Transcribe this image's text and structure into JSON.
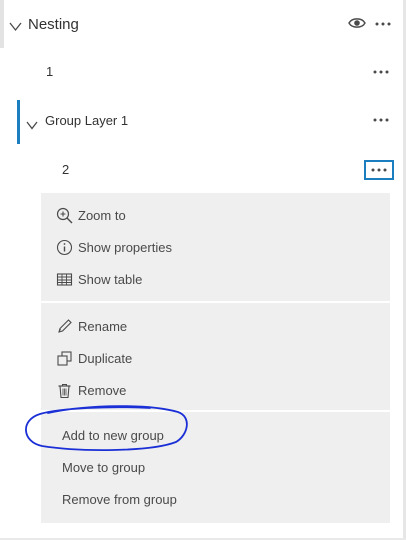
{
  "root_layer": {
    "title": "Nesting",
    "visibility_icon": "eye-icon",
    "options_icon": "ellipsis-icon"
  },
  "layers": {
    "layer_1": {
      "title": "1"
    },
    "group_layer": {
      "title": "Group Layer 1"
    },
    "layer_2": {
      "title": "2"
    }
  },
  "context_menu": {
    "section_1": [
      {
        "label": "Zoom to",
        "icon": "zoom-in-icon"
      },
      {
        "label": "Show properties",
        "icon": "info-icon"
      },
      {
        "label": "Show table",
        "icon": "table-icon"
      }
    ],
    "section_2": [
      {
        "label": "Rename",
        "icon": "pencil-icon"
      },
      {
        "label": "Duplicate",
        "icon": "duplicate-icon"
      },
      {
        "label": "Remove",
        "icon": "trash-icon"
      }
    ],
    "section_3": [
      {
        "label": "Add to new group"
      },
      {
        "label": "Move to group"
      },
      {
        "label": "Remove from group"
      }
    ]
  },
  "colors": {
    "accent": "#1b7fbf",
    "annotation": "#1a2fd6",
    "menu_bg": "#efefef"
  }
}
